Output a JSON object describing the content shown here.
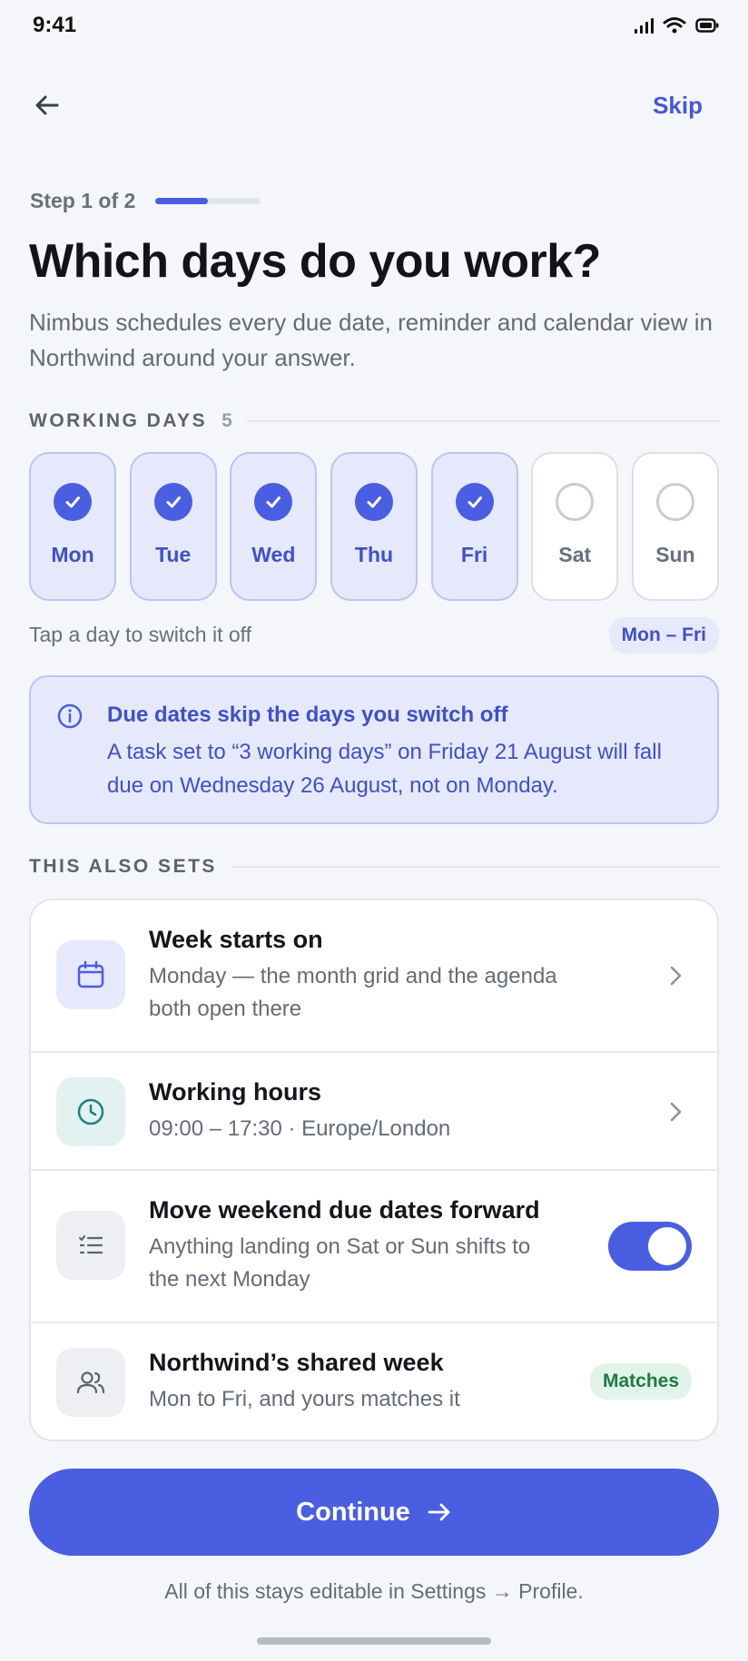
{
  "status_bar": {
    "time": "9:41"
  },
  "nav": {
    "skip_label": "Skip"
  },
  "step": {
    "label": "Step 1 of 2",
    "progress": 0.5
  },
  "title": "Which days do you work?",
  "subtitle": "Nimbus schedules every due date, reminder and calendar view in Northwind around your answer.",
  "working_days": {
    "section_label": "WORKING DAYS",
    "count": "5",
    "days": [
      {
        "label": "Mon",
        "on": true
      },
      {
        "label": "Tue",
        "on": true
      },
      {
        "label": "Wed",
        "on": true
      },
      {
        "label": "Thu",
        "on": true
      },
      {
        "label": "Fri",
        "on": true
      },
      {
        "label": "Sat",
        "on": false
      },
      {
        "label": "Sun",
        "on": false
      }
    ],
    "hint": "Tap a day to switch it off",
    "range": "Mon – Fri"
  },
  "info": {
    "title": "Due dates skip the days you switch off",
    "text": "A task set to “3 working days” on Friday 21 August will fall due on Wednesday 26 August, not on Monday."
  },
  "also_sets": {
    "section_label": "THIS ALSO SETS",
    "rows": [
      {
        "title": "Week starts on",
        "subtitle": "Monday — the month grid and the agenda both open there",
        "icon": "calendar-icon",
        "control": "chevron"
      },
      {
        "title": "Working hours",
        "subtitle": "09:00 – 17:30 · Europe/London",
        "icon": "clock-icon",
        "control": "chevron"
      },
      {
        "title": "Move weekend due dates forward",
        "subtitle": "Anything landing on Sat or Sun shifts to the next Monday",
        "icon": "list-icon",
        "control": "toggle",
        "toggle_on": true
      },
      {
        "title": "Northwind’s shared week",
        "subtitle": "Mon to Fri, and yours matches it",
        "icon": "team-icon",
        "control": "badge",
        "badge": "Matches"
      }
    ]
  },
  "continue_label": "Continue",
  "footnote": "All of this stays editable in Settings → Profile.",
  "colors": {
    "accent": "#4a5ee2",
    "accent_soft": "#e6e9fb",
    "success": "#1e7a45"
  }
}
